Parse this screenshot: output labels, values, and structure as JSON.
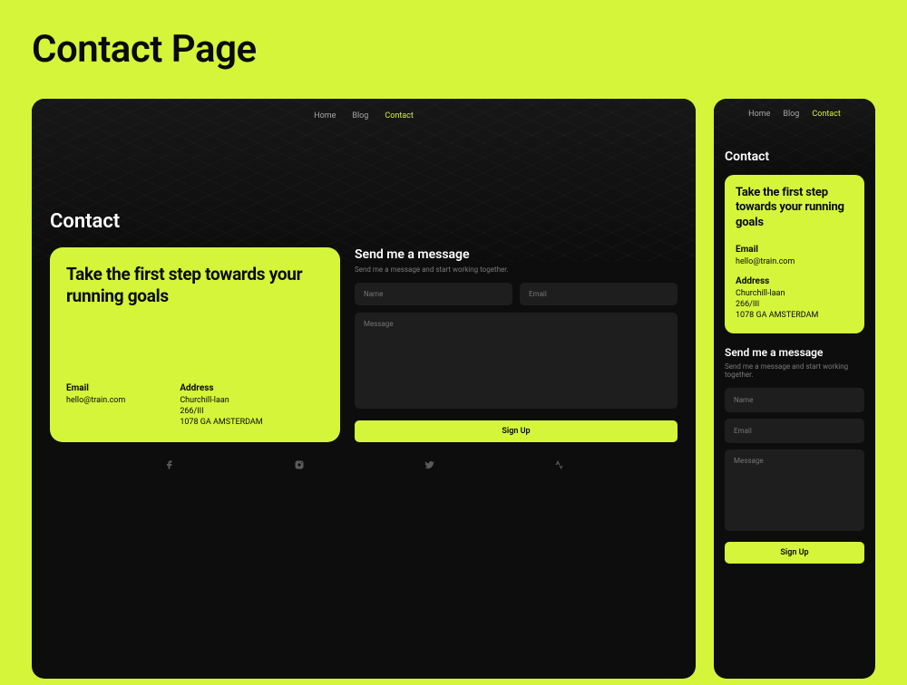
{
  "page": {
    "title": "Contact Page"
  },
  "nav": {
    "items": [
      {
        "label": "Home"
      },
      {
        "label": "Blog"
      },
      {
        "label": "Contact",
        "active": true
      }
    ]
  },
  "heading": "Contact",
  "card": {
    "title": "Take the first step towards your running goals",
    "email_label": "Email",
    "email_value": "hello@train.com",
    "address_label": "Address",
    "address_value": "Churchill-laan\n266/III\n1078 GA AMSTERDAM"
  },
  "form": {
    "title": "Send me a message",
    "subtitle": "Send me a message and start working together.",
    "name_placeholder": "Name",
    "email_placeholder": "Email",
    "message_placeholder": "Message",
    "button_label": "Sign Up"
  },
  "colors": {
    "accent": "#d4f53a",
    "bg_dark": "#0d0d0d",
    "input_bg": "#1e1e1e"
  }
}
